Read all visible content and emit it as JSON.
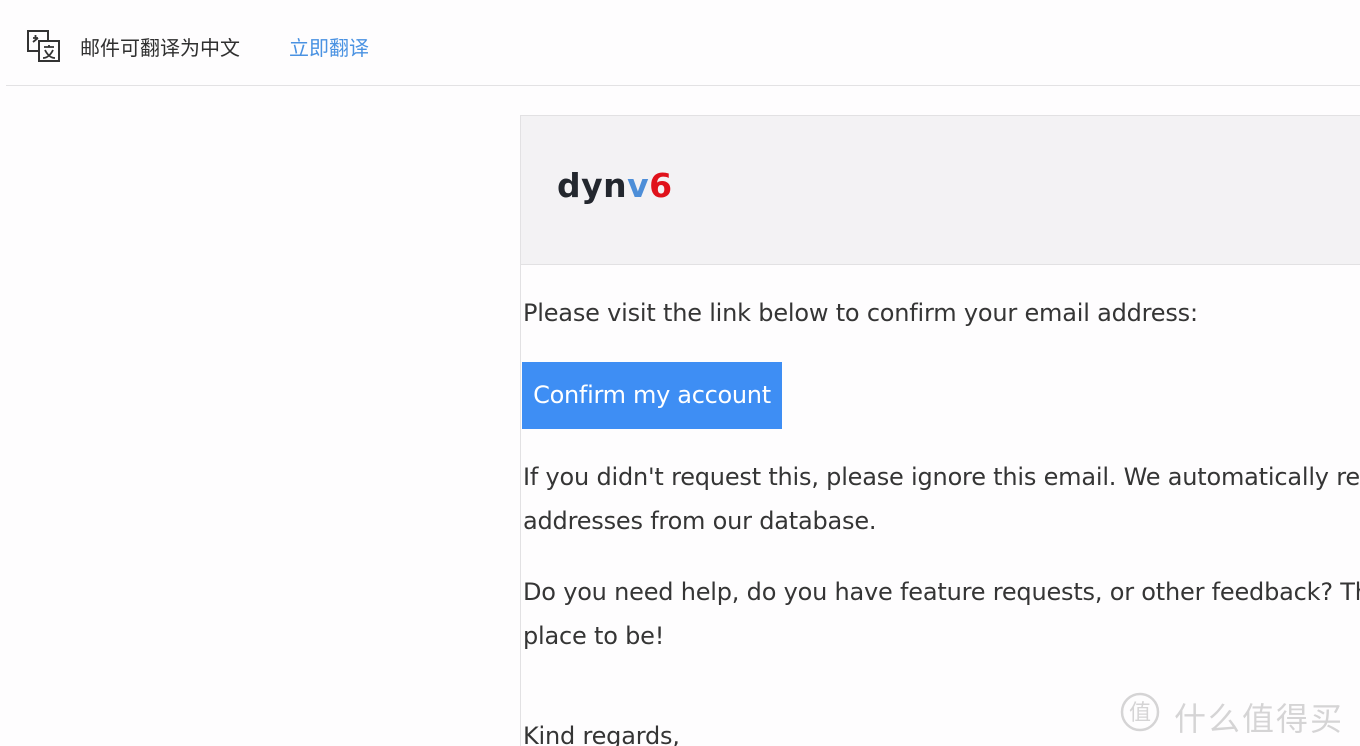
{
  "translate_bar": {
    "icon": "translate-icon",
    "prompt": "邮件可翻译为中文",
    "action": "立即翻译"
  },
  "email": {
    "logo": {
      "part1": "dyn",
      "part2": "v",
      "part3": "6"
    },
    "intro": "Please visit the link below to confirm your email address:",
    "confirm_button": "Confirm my account",
    "ignore_line1": "If you didn't request this, please ignore this email. We automatically rem",
    "ignore_line2": "addresses from our database.",
    "help_line1": "Do you need help, do you have feature requests, or other feedback? Th",
    "help_line2": "place to be!",
    "signoff": "Kind regards,"
  },
  "watermark": {
    "text": "什么值得买"
  },
  "colors": {
    "link": "#4a92e2",
    "button": "#3e8ef4",
    "logo_dark": "#23272e",
    "logo_blue": "#4d8ed8",
    "logo_red": "#e0121b",
    "header_bg": "#f3f2f4"
  }
}
